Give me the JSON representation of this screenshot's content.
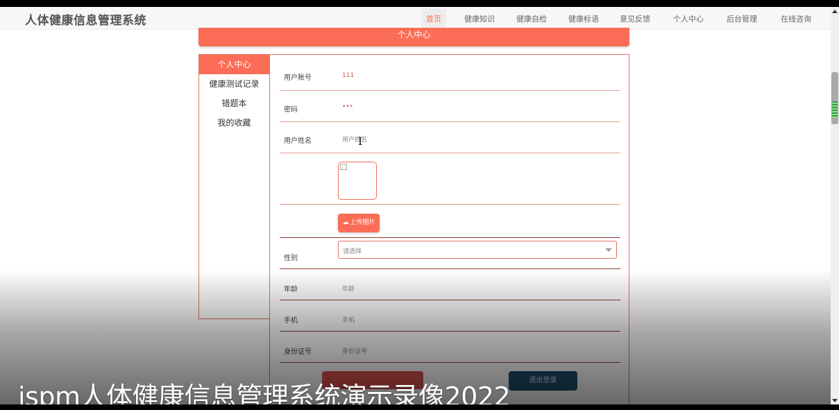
{
  "app": {
    "title": "人体健康信息管理系统"
  },
  "nav": {
    "items": [
      "首页",
      "健康知识",
      "健康自检",
      "健康标语",
      "意见反馈",
      "个人中心",
      "后台管理",
      "在线咨询"
    ],
    "active_index": 0
  },
  "page": {
    "header": "个人中心"
  },
  "sidebar": {
    "items": [
      "个人中心",
      "健康测试记录",
      "错题本",
      "我的收藏"
    ],
    "active_index": 0
  },
  "form": {
    "account": {
      "label": "用户账号",
      "value": "111"
    },
    "password": {
      "label": "密码",
      "value": "•••"
    },
    "name": {
      "label": "用户姓名",
      "placeholder": "用户姓名"
    },
    "upload": {
      "label": "上传图片",
      "icon": "cloud-upload-icon"
    },
    "gender": {
      "label": "性别",
      "placeholder": "请选择"
    },
    "age": {
      "label": "年龄",
      "placeholder": "年龄"
    },
    "phone": {
      "label": "手机",
      "placeholder": "手机"
    },
    "idcard": {
      "label": "身份证号",
      "placeholder": "身份证号"
    }
  },
  "buttons": {
    "logout": "退出登录"
  },
  "overlay": {
    "caption": "jspm人体健康信息管理系统演示录像2022"
  },
  "colors": {
    "accent": "#fb6d56",
    "value_red": "#d9534f",
    "logout_bg": "#1f4e6e"
  }
}
